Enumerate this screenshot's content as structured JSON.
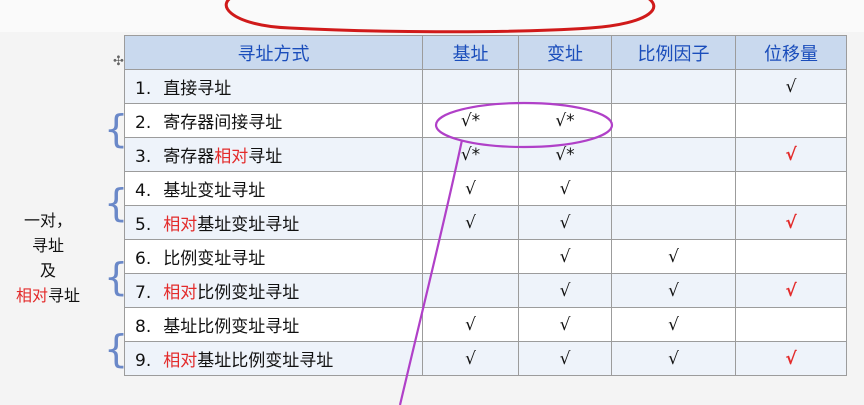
{
  "title": "寻址方式",
  "table": {
    "headers": [
      "寻址方式",
      "基址",
      "变址",
      "比例因子",
      "位移量"
    ],
    "rows": [
      {
        "no": "1.",
        "pre": "直接寻址",
        "hl": "",
        "post": "",
        "base": "",
        "index": "",
        "scale": "",
        "disp": "√",
        "disp_red": false
      },
      {
        "no": "2.",
        "pre": "寄存器间接寻址",
        "hl": "",
        "post": "",
        "base": "√*",
        "index": "√*",
        "scale": "",
        "disp": "",
        "disp_red": false
      },
      {
        "no": "3.",
        "pre": "寄存器",
        "hl": "相对",
        "post": "寻址",
        "base": "√*",
        "index": "√*",
        "scale": "",
        "disp": "√",
        "disp_red": true
      },
      {
        "no": "4.",
        "pre": "基址变址寻址",
        "hl": "",
        "post": "",
        "base": "√",
        "index": "√",
        "scale": "",
        "disp": "",
        "disp_red": false
      },
      {
        "no": "5.",
        "pre": "",
        "hl": "相对",
        "post": "基址变址寻址",
        "base": "√",
        "index": "√",
        "scale": "",
        "disp": "√",
        "disp_red": true
      },
      {
        "no": "6.",
        "pre": "比例变址寻址",
        "hl": "",
        "post": "",
        "base": "",
        "index": "√",
        "scale": "√",
        "disp": "",
        "disp_red": false
      },
      {
        "no": "7.",
        "pre": "",
        "hl": "相对",
        "post": "比例变址寻址",
        "base": "",
        "index": "√",
        "scale": "√",
        "disp": "√",
        "disp_red": true
      },
      {
        "no": "8.",
        "pre": "基址比例变址寻址",
        "hl": "",
        "post": "",
        "base": "√",
        "index": "√",
        "scale": "√",
        "disp": "",
        "disp_red": false
      },
      {
        "no": "9.",
        "pre": "",
        "hl": "相对",
        "post": "基址比例变址寻址",
        "base": "√",
        "index": "√",
        "scale": "√",
        "disp": "√",
        "disp_red": true
      }
    ]
  },
  "side_label": {
    "line1": "一对，",
    "line2": "寻址",
    "line3": "及",
    "line4_red": "相对",
    "line4_rest": "寻址"
  },
  "colors": {
    "header_bg": "#c9d9ee",
    "header_text": "#1a4dbb",
    "highlight_red": "#e32b2b",
    "annotation_purple": "#b040c8"
  }
}
